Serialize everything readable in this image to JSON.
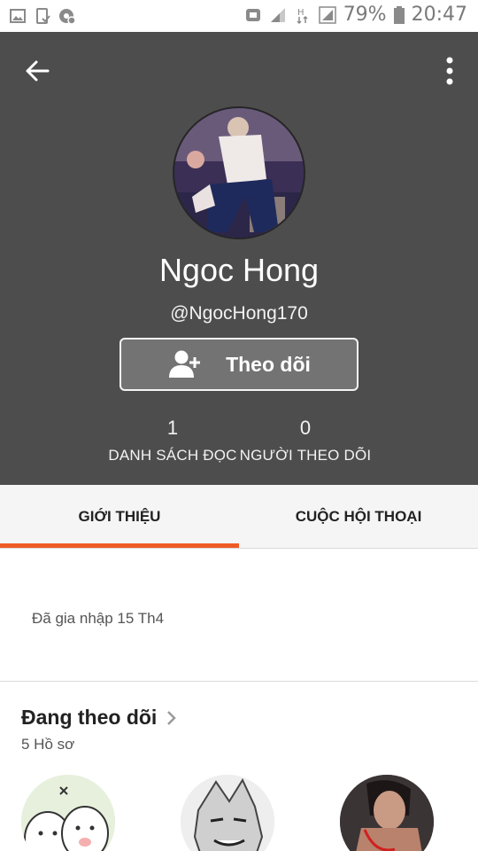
{
  "status_bar": {
    "battery": "79%",
    "time": "20:47",
    "icons": [
      "image-icon",
      "phone-check-icon",
      "settings-badge-icon",
      "sync-icon",
      "signal-icon",
      "hplus-icon",
      "signal-boxed-icon",
      "battery-icon"
    ]
  },
  "header": {
    "background": "#4d4d4d",
    "back_icon": "arrow-left-icon",
    "more_icon": "more-vertical-icon"
  },
  "profile": {
    "name": "Ngoc Hong",
    "handle": "@NgocHong170",
    "follow_button": {
      "label": "Theo dõi",
      "icon": "add-user-icon"
    },
    "stats": [
      {
        "value": "1",
        "label": "DANH SÁCH ĐỌC"
      },
      {
        "value": "0",
        "label": "NGƯỜI THEO DÕI"
      }
    ]
  },
  "tabs": [
    {
      "label": "GIỚI THIỆU",
      "active": true
    },
    {
      "label": "CUỘC HỘI THOẠI",
      "active": false
    }
  ],
  "accent_color": "#ef5a24",
  "about": {
    "joined": "Đã gia nhập 15 Th4"
  },
  "following": {
    "title": "Đang theo dõi",
    "count": "5 Hồ sơ",
    "avatars": [
      "following-avatar-1",
      "following-avatar-2",
      "following-avatar-3"
    ]
  }
}
